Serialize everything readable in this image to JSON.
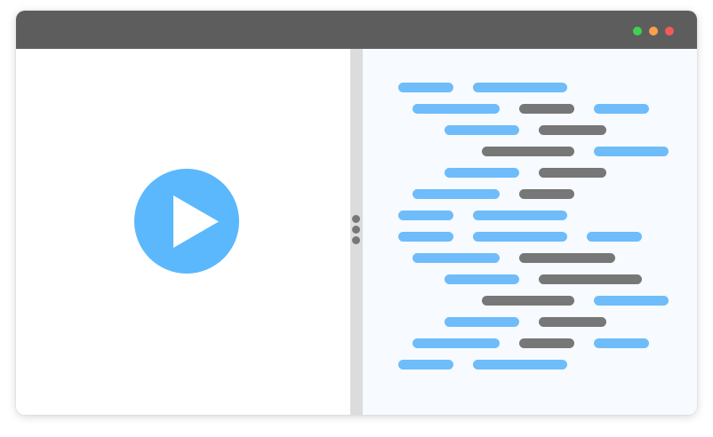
{
  "window": {
    "controls": [
      {
        "name": "maximize",
        "color": "#3fd14f"
      },
      {
        "name": "minimize",
        "color": "#f9a14e"
      },
      {
        "name": "close",
        "color": "#f25a5a"
      }
    ]
  },
  "player": {
    "icon": "play-icon",
    "circle_color": "#5bb8fc",
    "triangle_color": "#ffffff"
  },
  "splitter": {
    "icon": "drag-handle-icon",
    "color": "#777777"
  },
  "code": {
    "colors": {
      "keyword": "#6ebcfa",
      "value": "#777777"
    },
    "token_type_sequence": [
      [
        "keyword",
        "keyword"
      ],
      [
        "keyword",
        "value",
        "keyword"
      ],
      [
        "keyword",
        "value"
      ],
      [
        "value",
        "keyword"
      ],
      [
        "keyword",
        "value"
      ],
      [
        "keyword",
        "value"
      ],
      [
        "keyword",
        "keyword"
      ],
      [
        "keyword",
        "keyword",
        "keyword"
      ],
      [
        "keyword",
        "value"
      ],
      [
        "keyword",
        "value"
      ],
      [
        "value",
        "keyword"
      ],
      [
        "keyword",
        "value"
      ],
      [
        "keyword",
        "value",
        "keyword"
      ],
      [
        "keyword",
        "keyword"
      ]
    ]
  }
}
